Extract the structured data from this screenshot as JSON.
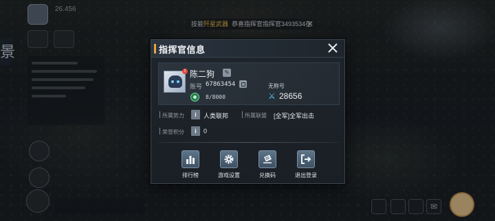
{
  "hud": {
    "side_glyph": "景",
    "level_text": "26.456"
  },
  "broadcast": {
    "prefix": "技能",
    "highlight": "歼星武器",
    "message": "恭喜指挥官指挥官3493534在",
    "close_icon": "close-icon"
  },
  "dialog": {
    "title": "指挥官信息",
    "close_icon": "close-icon"
  },
  "profile": {
    "avatar_badge": "!",
    "name": "陈二狗",
    "rename_icon": "edit-icon",
    "account_label": "账号",
    "account_value": "67863454",
    "energy_value": "8/8000",
    "title_label": "无称号",
    "power_value": "28656"
  },
  "details": {
    "faction_label": "所属势力",
    "faction_value": "人类联邦",
    "alliance_label": "所属联盟",
    "alliance_value": "[全军]全军出击",
    "honor_label": "荣誉积分",
    "honor_value": "0",
    "info_glyph": "i"
  },
  "actions": [
    {
      "label": "排行榜",
      "icon": "leaderboard-icon"
    },
    {
      "label": "游戏设置",
      "icon": "gear-icon"
    },
    {
      "label": "兑换码",
      "icon": "ticket-icon"
    },
    {
      "label": "退出登录",
      "icon": "logout-icon"
    }
  ],
  "colors": {
    "accent": "#e8a33c",
    "highlight": "#f3c14a",
    "power": "#5fd1ff"
  }
}
